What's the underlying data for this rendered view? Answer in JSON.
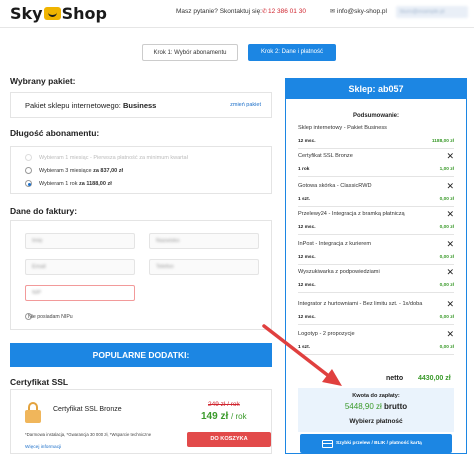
{
  "header": {
    "logo_left": "Sky",
    "logo_right": "Shop",
    "question": "Masz pytanie? Skontaktuj się:",
    "phone": "12 386 01 30",
    "email": "info@sky-shop.pl",
    "user": "biuro@example.pl"
  },
  "steps": [
    {
      "label": "Krok 1: Wybór abonamentu"
    },
    {
      "label": "Krok 2: Dane i płatność"
    }
  ],
  "package": {
    "title": "Wybrany pakiet:",
    "text_prefix": "Pakiet sklepu internetowego:",
    "name": "Business",
    "change": "zmień pakiet"
  },
  "duration": {
    "title": "Długość abonamentu:",
    "options": [
      {
        "label": "Wybieram 1 miesiąc - Pierwsza płatność za minimum kwartał",
        "disabled": true,
        "selected": false
      },
      {
        "label_prefix": "Wybieram 3 miesiące",
        "label_price": "za 837,00 zł",
        "disabled": false,
        "selected": false
      },
      {
        "label_prefix": "Wybieram 1 rok",
        "label_price": "za 1188,00 zł",
        "disabled": false,
        "selected": true
      }
    ]
  },
  "invoice": {
    "title": "Dane do faktury:",
    "fields": [
      "Imię",
      "Nazwisko",
      "Email",
      "Telefon",
      "NIP"
    ],
    "nip_label": "Nie posiadam NIPu"
  },
  "addons_button": "POPULARNE DODATKI:",
  "ssl": {
    "title": "Certyfikat SSL",
    "name": "Certyfikat SSL Bronze",
    "old_price": "249 zł / rok",
    "new_price": "149 zł",
    "per": "/ rok",
    "note": "*Darmowa instalacja, *Gwarancja 30 000 zł, *Wsparcie techniczne",
    "cart_button": "DO KOSZYKA",
    "more": "Więcej informacji"
  },
  "sidebar": {
    "shop": "Sklep: ab057",
    "summary_title": "Podsumowanie:",
    "items": [
      {
        "name": "Sklep internetowy - Pakiet Business",
        "qty": "12 msc.",
        "price": "1188,00 zł",
        "removable": false
      },
      {
        "name": "Certyfikat SSL Bronze",
        "qty": "1 rok",
        "price": "1,00 zł",
        "removable": true
      },
      {
        "name": "Gotowa skórka - ClassicRWD",
        "qty": "1 szt.",
        "price": "0,00 zł",
        "removable": true
      },
      {
        "name": "Przelewy24 - Integracja z bramką płatniczą",
        "qty": "12 msc.",
        "price": "0,00 zł",
        "removable": true
      },
      {
        "name": "InPost - Integracja z kurierem",
        "qty": "12 msc.",
        "price": "0,00 zł",
        "removable": true
      },
      {
        "name": "Wyszukiwarka z podpowiedziami",
        "qty": "12 msc.",
        "price": "0,00 zł",
        "removable": true
      },
      {
        "name": "Integrator z hurtowniami - Bez limitu szt. - 1x/doba",
        "qty": "12 msc.",
        "price": "0,00 zł",
        "removable": true
      },
      {
        "name": "Logotyp - 2 propozycje",
        "qty": "1 szt.",
        "price": "0,00 zł",
        "removable": true
      }
    ],
    "netto_label": "netto",
    "netto_value": "4430,00 zł",
    "pay_label": "Kwota do zapłaty:",
    "pay_value": "5448,90 zł",
    "pay_suffix": "brutto",
    "choose_payment": "Wybierz płatność",
    "pay_button": "Szybki przelew / BLIK / płatność kartą"
  },
  "colors": {
    "accent": "#1c86e3",
    "price_green": "#3a9a2a",
    "danger": "#e24a4a",
    "arrow": "#e0403f"
  }
}
